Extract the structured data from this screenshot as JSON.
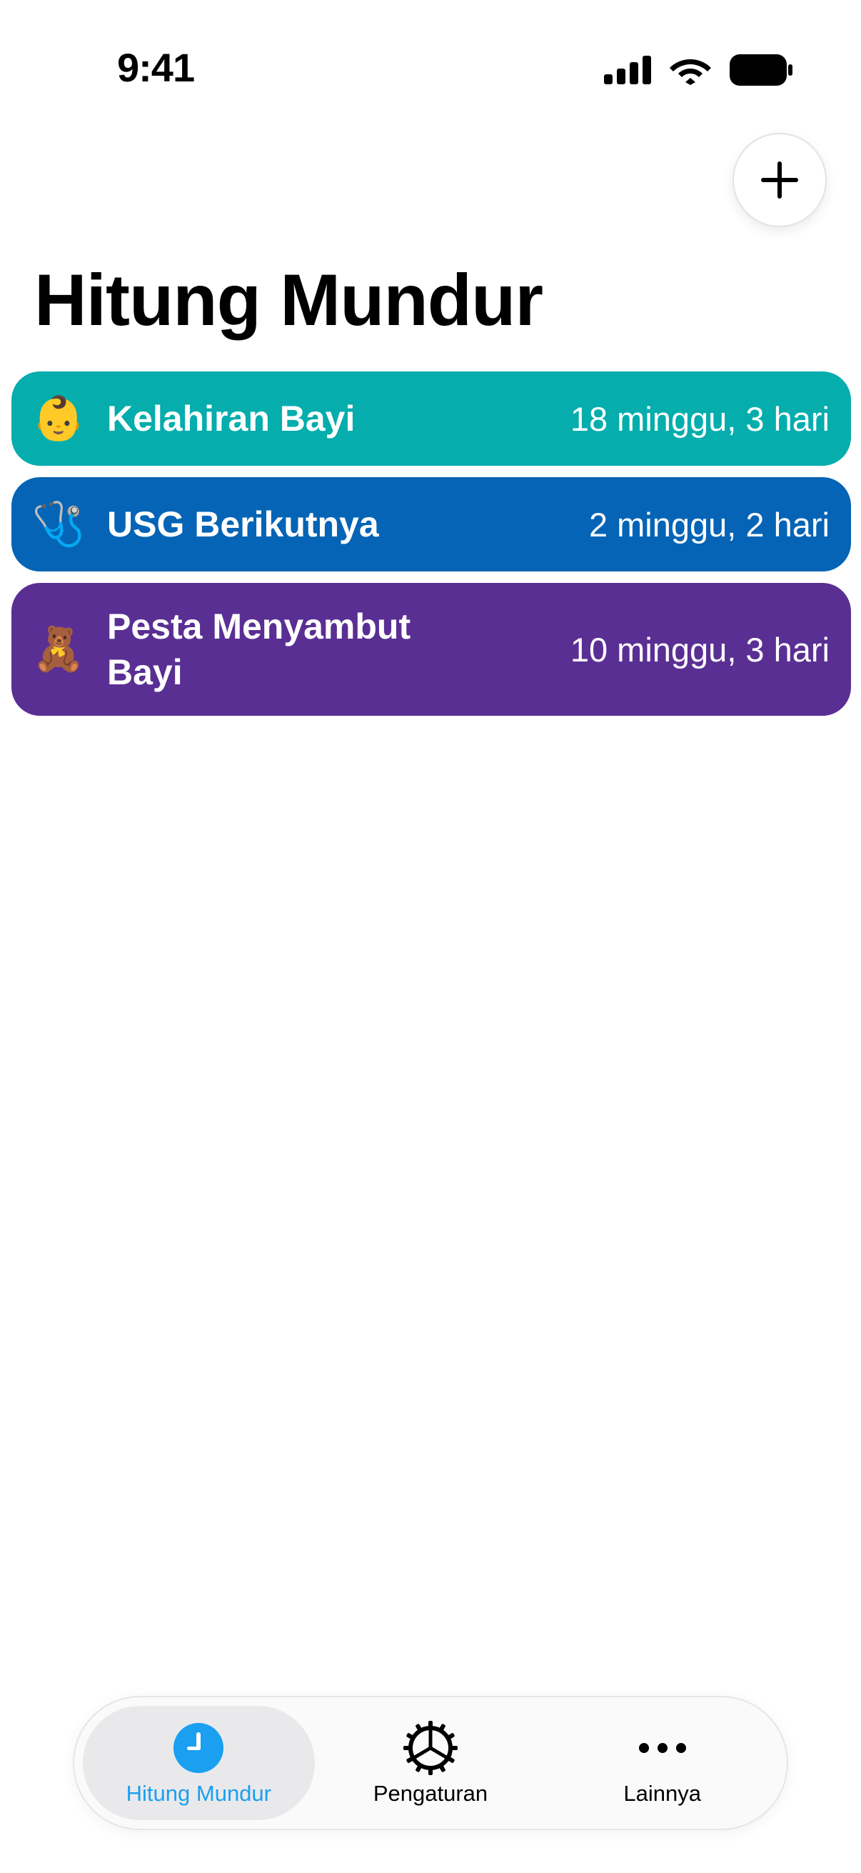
{
  "status_bar": {
    "time": "9:41"
  },
  "header": {
    "add_button_icon": "plus-icon",
    "title": "Hitung Mundur"
  },
  "countdowns": [
    {
      "emoji": "👶",
      "title": "Kelahiran Bayi",
      "remaining": "18 minggu, 3 hari",
      "color": "#05ADAD"
    },
    {
      "emoji": "🩺",
      "title": "USG Berikutnya",
      "remaining": "2 minggu, 2 hari",
      "color": "#0564B5"
    },
    {
      "emoji": "🧸",
      "title": "Pesta Menyambut Bayi",
      "remaining": "10 minggu, 3 hari",
      "color": "#5A2F93"
    }
  ],
  "tab_bar": {
    "tabs": [
      {
        "label": "Hitung Mundur",
        "icon": "clock-icon",
        "active": true
      },
      {
        "label": "Pengaturan",
        "icon": "gear-icon",
        "active": false
      },
      {
        "label": "Lainnya",
        "icon": "more-icon",
        "active": false
      }
    ],
    "accent_color": "#1A9FF1"
  }
}
